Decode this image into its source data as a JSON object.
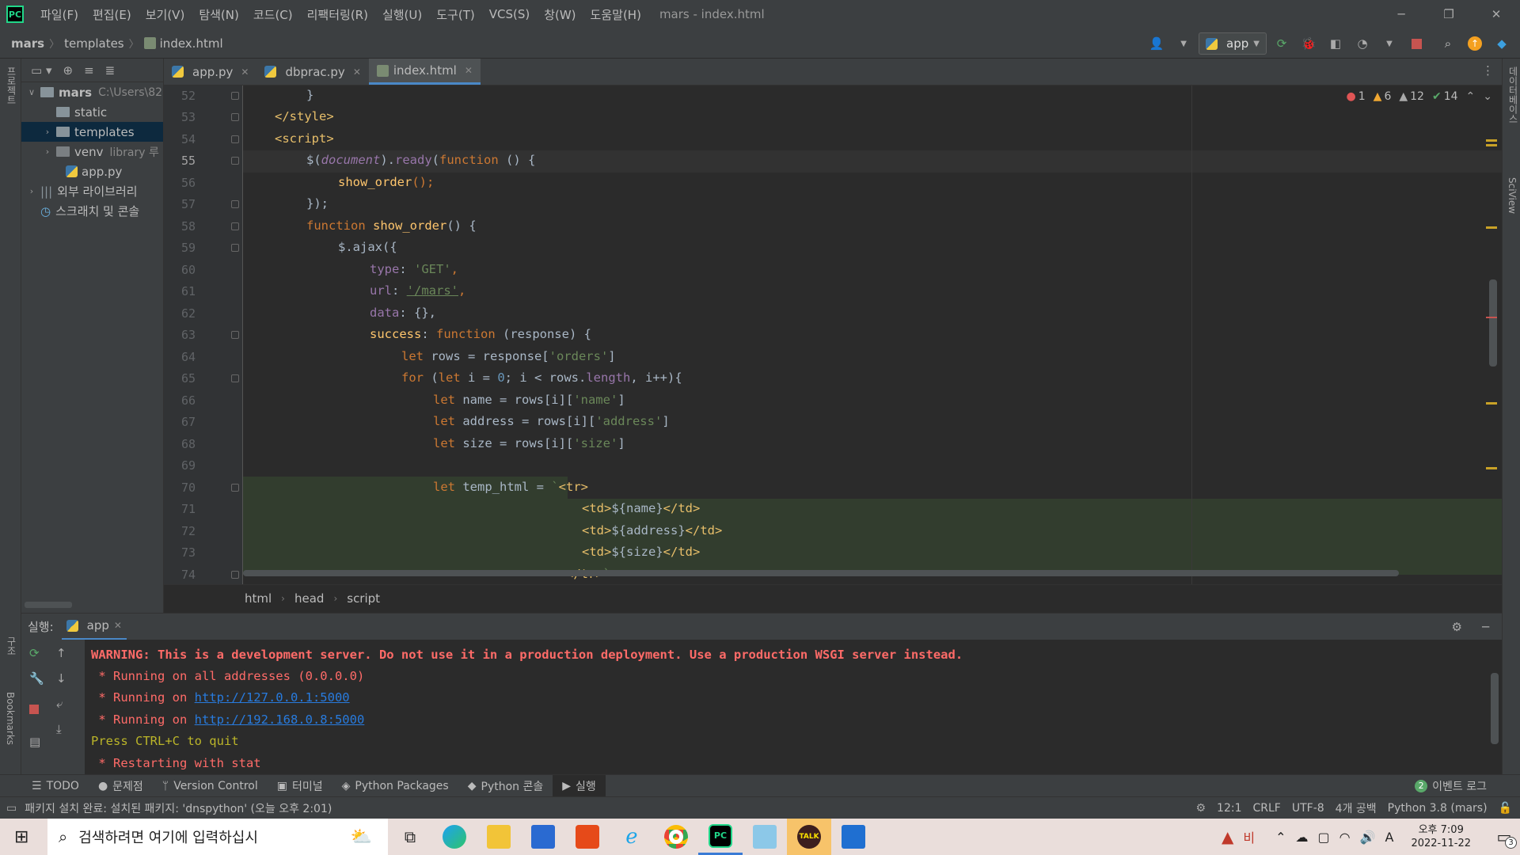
{
  "menu": [
    "파일(F)",
    "편집(E)",
    "보기(V)",
    "탐색(N)",
    "코드(C)",
    "리팩터링(R)",
    "실행(U)",
    "도구(T)",
    "VCS(S)",
    "창(W)",
    "도움말(H)"
  ],
  "window_title": "mars - index.html",
  "nav": {
    "project": "mars",
    "folder": "templates",
    "file": "index.html",
    "run_config": "app"
  },
  "left_strip": {
    "project": "프로젝트",
    "structure": "구조",
    "bookmarks": "Bookmarks"
  },
  "right_strip": {
    "database": "데이터베이스",
    "sciview": "SciView"
  },
  "project_tree": [
    {
      "label": "mars",
      "hint": "C:\\Users\\82"
    },
    {
      "label": "static"
    },
    {
      "label": "templates"
    },
    {
      "label": "venv",
      "hint": "library 루"
    },
    {
      "label": "app.py"
    },
    {
      "label": "외부 라이브러리"
    },
    {
      "label": "스크래치 및 콘솔"
    }
  ],
  "tabs": [
    {
      "label": "app.py"
    },
    {
      "label": "dbprac.py"
    },
    {
      "label": "index.html"
    }
  ],
  "inspections": {
    "errors": "1",
    "warnings": "6",
    "weak": "12",
    "ok": "14"
  },
  "line_numbers": [
    "52",
    "53",
    "54",
    "55",
    "56",
    "57",
    "58",
    "59",
    "60",
    "61",
    "62",
    "63",
    "64",
    "65",
    "66",
    "67",
    "68",
    "69",
    "70",
    "71",
    "72",
    "73",
    "74"
  ],
  "code": {
    "l52": "}",
    "l53": "</style>",
    "l54": "<script>",
    "l55a": "$(",
    "l55b": "document",
    "l55c": ").",
    "l55d": "ready",
    "l55e": "(",
    "l55f": "function",
    "l55g": " () {",
    "l56a": "show_order",
    "l56b": "();",
    "l57": "});",
    "l58a": "function ",
    "l58b": "show_order",
    "l58c": "() {",
    "l59a": "$.",
    "l59b": "ajax",
    "l59c": "({",
    "l60a": "type",
    "l60b": ": ",
    "l60c": "'GET'",
    "l60d": ",",
    "l61a": "url",
    "l61b": ": ",
    "l61c": "'/mars'",
    "l61d": ",",
    "l62a": "data",
    "l62b": ": {},",
    "l63a": "success",
    "l63b": ": ",
    "l63c": "function",
    "l63d": " (response) {",
    "l64a": "let ",
    "l64b": "rows = response[",
    "l64c": "'orders'",
    "l64d": "]",
    "l65a": "for ",
    "l65b": "(",
    "l65c": "let ",
    "l65d": "i = ",
    "l65e": "0",
    "l65f": "; i < rows.",
    "l65g": "length",
    "l65h": ", i++){",
    "l66a": "let ",
    "l66b": "name = rows[i][",
    "l66c": "'name'",
    "l66d": "]",
    "l67a": "let ",
    "l67b": "address = rows[i][",
    "l67c": "'address'",
    "l67d": "]",
    "l68a": "let ",
    "l68b": "size = rows[i][",
    "l68c": "'size'",
    "l68d": "]",
    "l70a": "let ",
    "l70b": "temp_html = ",
    "l70c": "`",
    "l70d": "<tr>",
    "l71a": "<td>",
    "l71b": "${name}",
    "l71c": "</td>",
    "l72a": "<td>",
    "l72b": "${address}",
    "l72c": "</td>",
    "l73a": "<td>",
    "l73b": "${size}",
    "l73c": "</td>",
    "l74a": "</tr>",
    "l74b": "`"
  },
  "editor_breadcrumb": [
    "html",
    "head",
    "script"
  ],
  "run_panel": {
    "label": "실행:",
    "tab": "app"
  },
  "console": {
    "warning": "WARNING: This is a development server. Do not use it in a production deployment. Use a production WSGI server instead.",
    "running_all": " * Running on all addresses (0.0.0.0)",
    "running_on": " * Running on ",
    "url1": "http://127.0.0.1:5000",
    "url2": "http://192.168.0.8:5000",
    "quit": "Press CTRL+C to quit",
    "restart": " * Restarting with stat"
  },
  "tool_windows": [
    "TODO",
    "문제점",
    "Version Control",
    "터미널",
    "Python Packages",
    "Python 콘솔",
    "실행"
  ],
  "event_log": {
    "count": "2",
    "label": "이벤트 로그"
  },
  "status": {
    "message": "패키지 설치 완료: 설치된 패키지: 'dnspython' (오늘 오후 2:01)",
    "position": "12:1",
    "line_sep": "CRLF",
    "encoding": "UTF-8",
    "indent": "4개 공백",
    "interpreter": "Python 3.8 (mars)"
  },
  "taskbar": {
    "search_placeholder": "검색하려면 여기에 입력하십시",
    "weather_label": "비",
    "ime": "A",
    "time": "오후 7:09",
    "date": "2022-11-22",
    "notifications": "3"
  },
  "colors": {
    "keyword": "#cc7832",
    "string": "#6a8759",
    "function": "#ffc66d",
    "tag": "#e8bf6a",
    "number": "#6897bb",
    "accent": "#4a88c7"
  }
}
